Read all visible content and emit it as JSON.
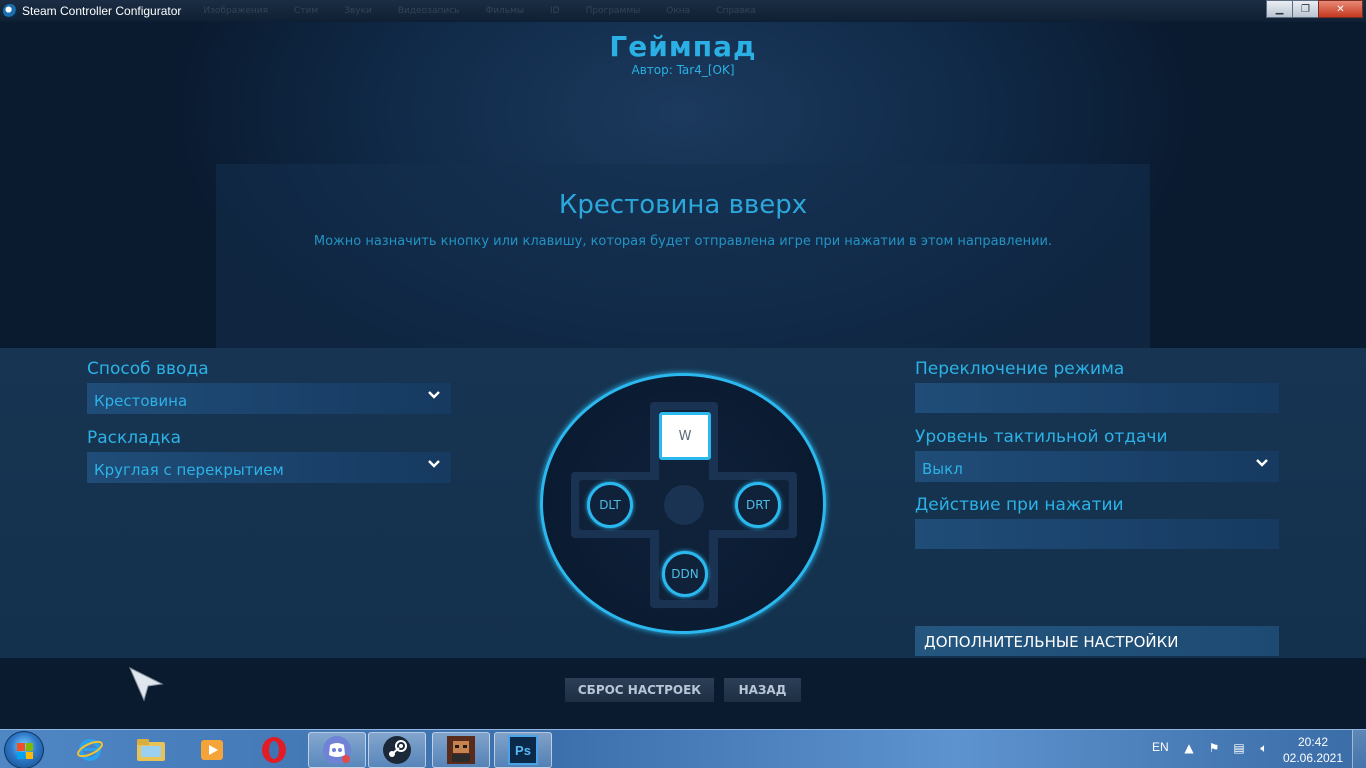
{
  "window": {
    "title": "Steam Controller Configurator",
    "ghost_menu": [
      "Изображения",
      "Стим",
      "Звуки",
      "Видеозапись",
      "Фильмы",
      "ID",
      "Программы",
      "Окна",
      "Справка"
    ],
    "minimize": "▁",
    "maximize": "❐",
    "close": "✕"
  },
  "header": {
    "title": "Геймпад",
    "author": "Автор: Tar4_[OK]"
  },
  "info": {
    "title": "Крестовина вверх",
    "description": "Можно назначить кнопку или клавишу, которая будет отправлена игре при нажатии в этом направлении."
  },
  "left": {
    "input_method_label": "Способ ввода",
    "input_method_value": "Крестовина",
    "layout_label": "Раскладка",
    "layout_value": "Круглая с перекрытием"
  },
  "dpad": {
    "up": "W",
    "left": "DLT",
    "right": "DRT",
    "down": "DDN"
  },
  "right": {
    "mode_switch_label": "Переключение режима",
    "haptic_label": "Уровень тактильной отдачи",
    "haptic_value": "Выкл",
    "press_action_label": "Действие при нажатии",
    "advanced_button": "ДОПОЛНИТЕЛЬНЫЕ НАСТРОЙКИ"
  },
  "buttons": {
    "reset": "СБРОС НАСТРОЕК",
    "back": "НАЗАД"
  },
  "taskbar": {
    "language": "EN",
    "time": "20:42",
    "date": "02.06.2021",
    "apps": [
      "internet-explorer",
      "file-explorer",
      "media-player",
      "opera",
      "discord",
      "steam",
      "game",
      "photoshop"
    ],
    "photoshop_label": "Ps"
  },
  "colors": {
    "accent": "#2ab0e4",
    "background": "#0d1d33",
    "taskbar": "#4f86c4"
  }
}
